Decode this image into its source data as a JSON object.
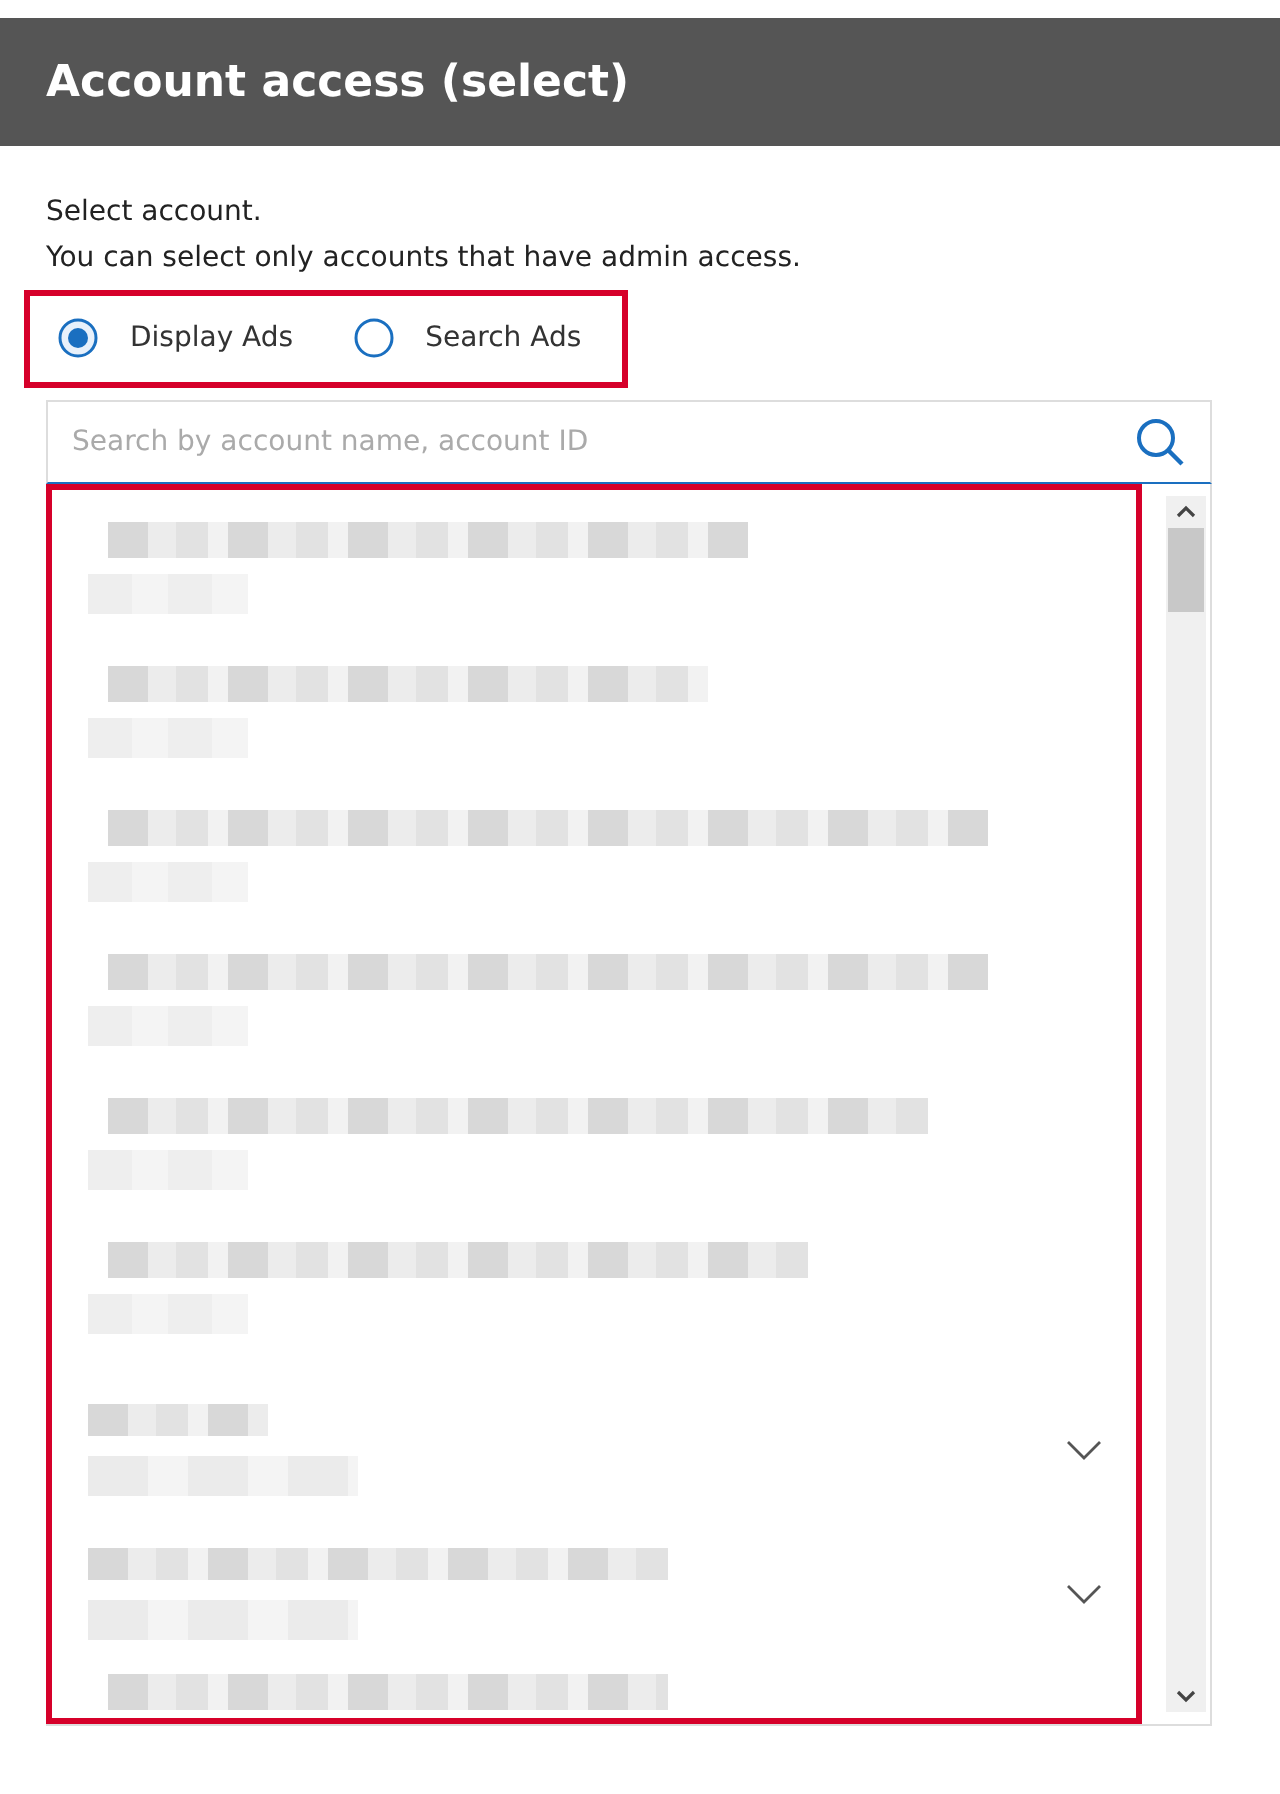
{
  "header": {
    "title": "Account access (select)"
  },
  "instructions": [
    "Select account.",
    "You can select only accounts that have admin access."
  ],
  "account_type": {
    "highlighted": true,
    "options": [
      {
        "label": "Display Ads",
        "selected": true
      },
      {
        "label": "Search Ads",
        "selected": false
      }
    ]
  },
  "search": {
    "placeholder": "Search by account name, account ID"
  },
  "account_list": {
    "highlighted": true,
    "rows": [
      {
        "kind": "account"
      },
      {
        "kind": "account"
      },
      {
        "kind": "account"
      },
      {
        "kind": "account"
      },
      {
        "kind": "account"
      },
      {
        "kind": "account"
      },
      {
        "kind": "group",
        "expanded": false
      },
      {
        "kind": "group",
        "expanded": false
      },
      {
        "kind": "account"
      }
    ]
  }
}
